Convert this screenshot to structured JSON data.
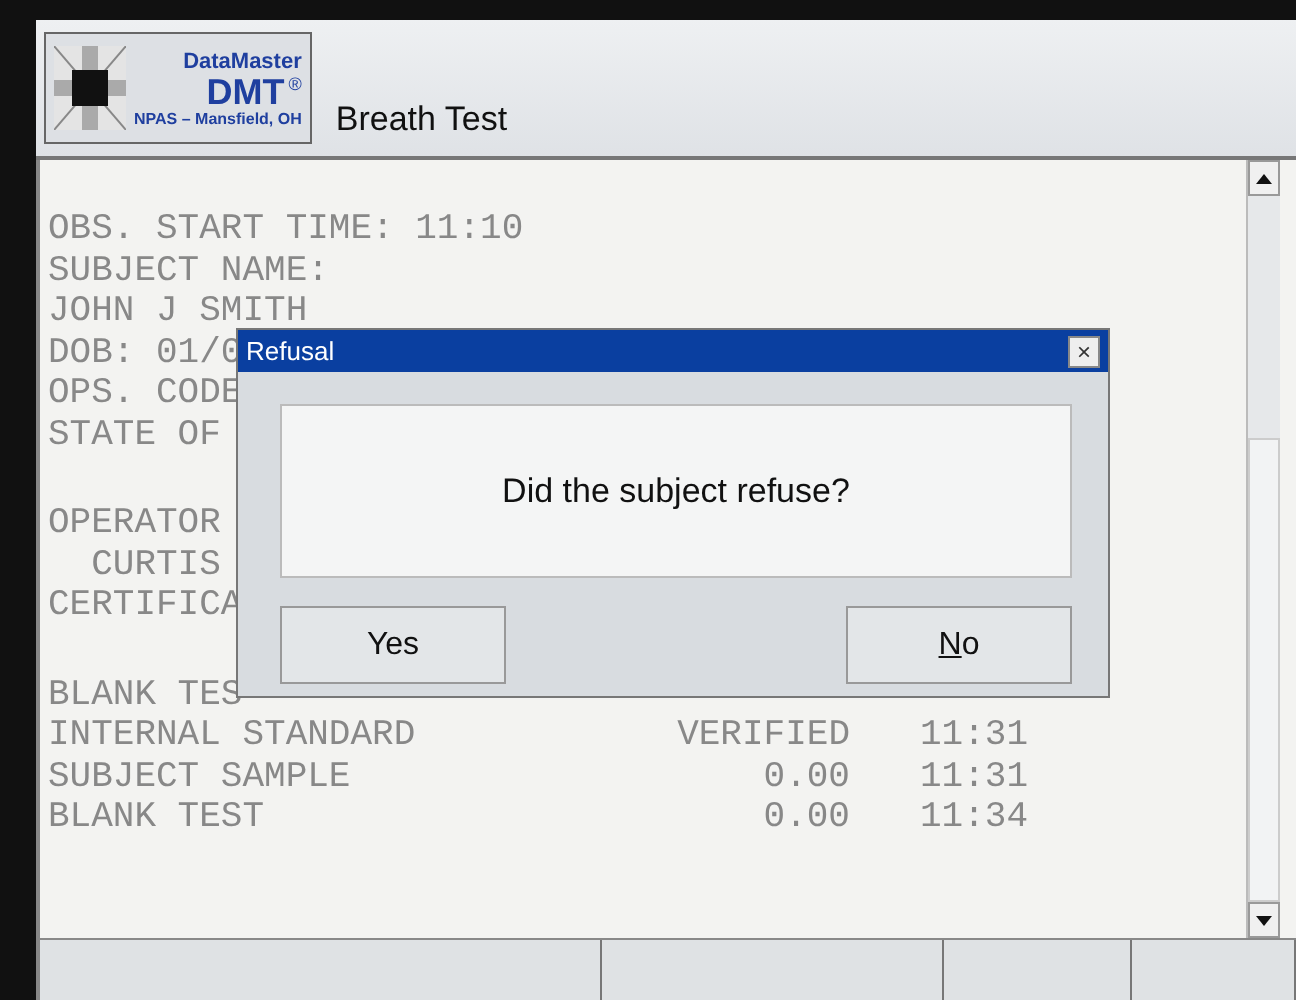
{
  "header": {
    "logo": {
      "line_1": "DataMaster",
      "line_2": "DMT",
      "mark": "®",
      "line_3": "NPAS – Mansfield, OH"
    },
    "title": "Breath Test"
  },
  "report": {
    "lines": [
      {
        "label": "OBS. START TIME: 11:10"
      },
      {
        "label": "SUBJECT NAME:"
      },
      {
        "label": "JOHN J SMITH"
      },
      {
        "label": "DOB: 01/0"
      },
      {
        "label": "OPS. CODE"
      },
      {
        "label": "STATE OF"
      },
      {
        "kind": "blank"
      },
      {
        "label": "OPERATOR"
      },
      {
        "label": "  CURTIS"
      },
      {
        "label": "CERTIFICA"
      },
      {
        "kind": "blank"
      },
      {
        "label": "BLANK TES"
      },
      {
        "label": "INTERNAL STANDARD",
        "value": "VERIFIED",
        "time": "11:31"
      },
      {
        "label": "SUBJECT SAMPLE",
        "value": "0.00",
        "time": "11:31"
      },
      {
        "label": "BLANK TEST",
        "value": "0.00",
        "time": "11:34"
      }
    ]
  },
  "dialog": {
    "title": "Refusal",
    "close": "×",
    "message": "Did the subject refuse?",
    "buttons": [
      {
        "label": "Yes"
      },
      {
        "label": "o",
        "mnemonic": "N"
      }
    ]
  }
}
